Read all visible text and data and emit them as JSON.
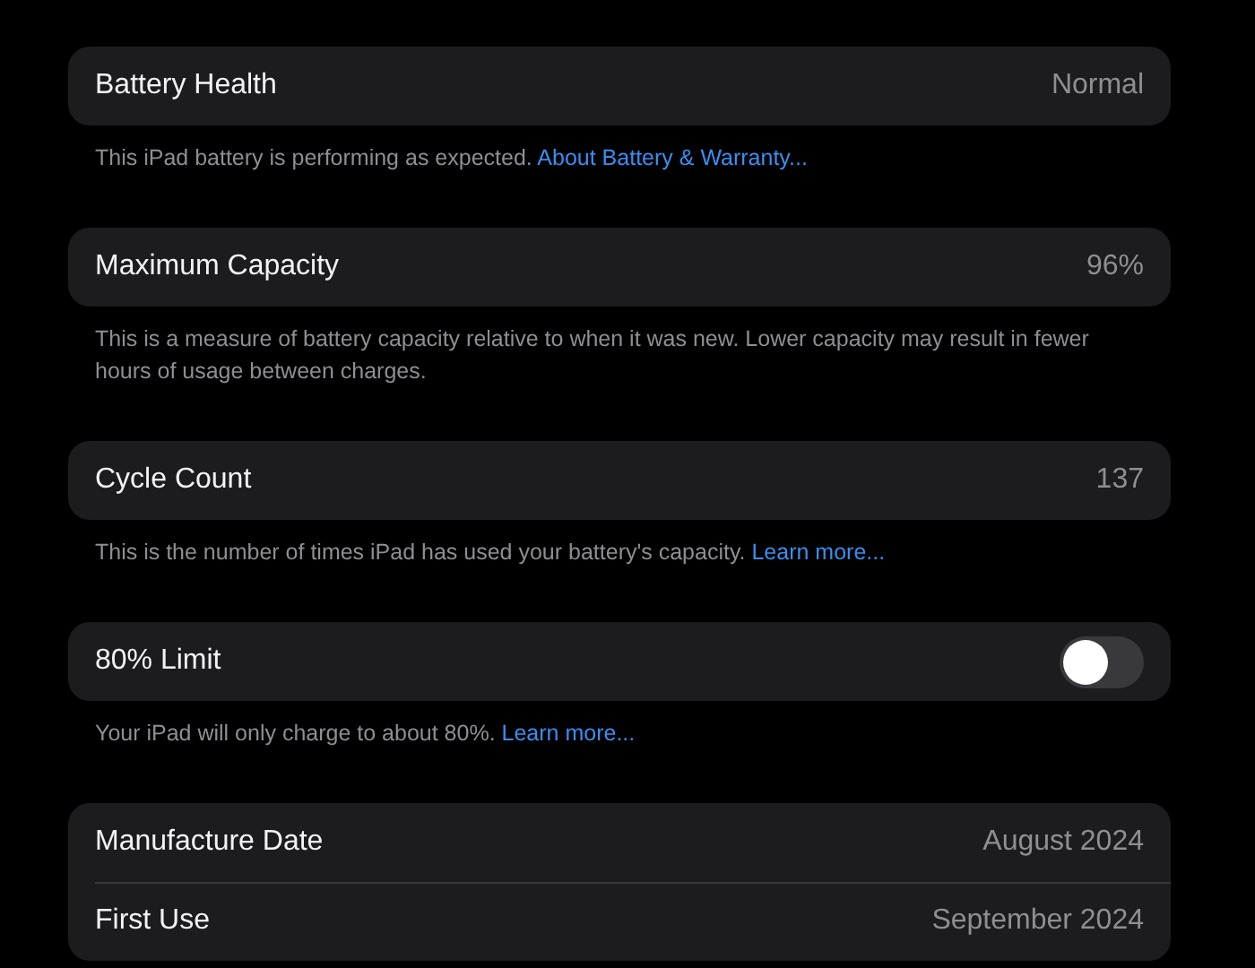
{
  "sections": [
    {
      "rows": [
        {
          "kind": "value",
          "label": "Battery Health",
          "value": "Normal"
        }
      ],
      "footer": {
        "text": "This iPad battery is performing as expected.",
        "link": "About Battery & Warranty..."
      }
    },
    {
      "rows": [
        {
          "kind": "value",
          "label": "Maximum Capacity",
          "value": "96%"
        }
      ],
      "footer": {
        "text": "This is a measure of battery capacity relative to when it was new. Lower capacity may result in fewer hours of usage between charges."
      }
    },
    {
      "rows": [
        {
          "kind": "value",
          "label": "Cycle Count",
          "value": "137"
        }
      ],
      "footer": {
        "text": "This is the number of times iPad has used your battery's capacity.",
        "link": "Learn more..."
      }
    },
    {
      "rows": [
        {
          "kind": "toggle",
          "label": "80% Limit",
          "on": false
        }
      ],
      "footer": {
        "text": "Your iPad will only charge to about 80%.",
        "link": "Learn more..."
      }
    },
    {
      "rows": [
        {
          "kind": "value",
          "label": "Manufacture Date",
          "value": "August 2024"
        },
        {
          "kind": "value",
          "label": "First Use",
          "value": "September 2024"
        }
      ]
    }
  ]
}
